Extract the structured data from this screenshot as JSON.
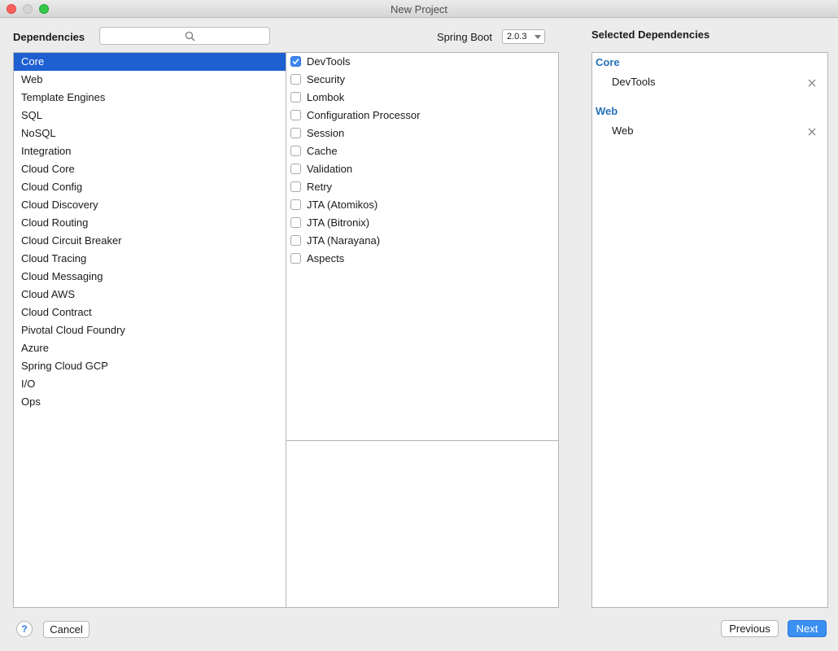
{
  "window": {
    "title": "New Project"
  },
  "header": {
    "dependencies_label": "Dependencies",
    "search_placeholder": "",
    "spring_boot_label": "Spring Boot",
    "spring_boot_version": "2.0.3"
  },
  "categories": [
    {
      "label": "Core",
      "selected": true
    },
    {
      "label": "Web"
    },
    {
      "label": "Template Engines"
    },
    {
      "label": "SQL"
    },
    {
      "label": "NoSQL"
    },
    {
      "label": "Integration"
    },
    {
      "label": "Cloud Core"
    },
    {
      "label": "Cloud Config"
    },
    {
      "label": "Cloud Discovery"
    },
    {
      "label": "Cloud Routing"
    },
    {
      "label": "Cloud Circuit Breaker"
    },
    {
      "label": "Cloud Tracing"
    },
    {
      "label": "Cloud Messaging"
    },
    {
      "label": "Cloud AWS"
    },
    {
      "label": "Cloud Contract"
    },
    {
      "label": "Pivotal Cloud Foundry"
    },
    {
      "label": "Azure"
    },
    {
      "label": "Spring Cloud GCP"
    },
    {
      "label": "I/O"
    },
    {
      "label": "Ops"
    }
  ],
  "dependencies": [
    {
      "label": "DevTools",
      "checked": true
    },
    {
      "label": "Security",
      "checked": false
    },
    {
      "label": "Lombok",
      "checked": false
    },
    {
      "label": "Configuration Processor",
      "checked": false
    },
    {
      "label": "Session",
      "checked": false
    },
    {
      "label": "Cache",
      "checked": false
    },
    {
      "label": "Validation",
      "checked": false
    },
    {
      "label": "Retry",
      "checked": false
    },
    {
      "label": "JTA (Atomikos)",
      "checked": false
    },
    {
      "label": "JTA (Bitronix)",
      "checked": false
    },
    {
      "label": "JTA (Narayana)",
      "checked": false
    },
    {
      "label": "Aspects",
      "checked": false
    }
  ],
  "selected": {
    "title": "Selected Dependencies",
    "groups": [
      {
        "name": "Core",
        "items": [
          "DevTools"
        ]
      },
      {
        "name": "Web",
        "items": [
          "Web"
        ]
      }
    ]
  },
  "footer": {
    "help": "?",
    "cancel": "Cancel",
    "previous": "Previous",
    "next": "Next"
  }
}
